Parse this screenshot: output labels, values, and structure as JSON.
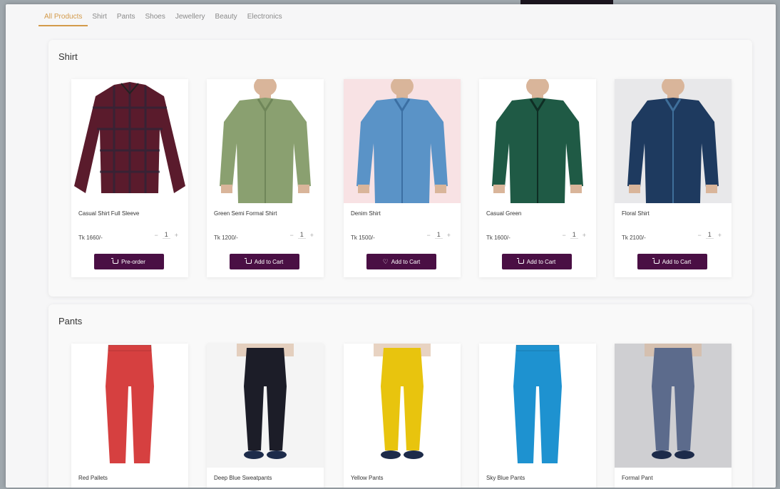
{
  "tabs": [
    "All Products",
    "Shirt",
    "Pants",
    "Shoes",
    "Jewellery",
    "Beauty",
    "Electronics"
  ],
  "active_tab": 0,
  "sections": [
    {
      "title": "Shirt",
      "products": [
        {
          "name": "Casual Shirt Full Sleeve",
          "price": "Tk 1660/-",
          "qty": "1",
          "button": "Pre-order",
          "icon": "cart-icon",
          "bg": "#ffffff",
          "color": "#5a1b2c",
          "accent": "#2b2638",
          "kind": "shirt"
        },
        {
          "name": "Green Semi Formal Shirt",
          "price": "Tk 1200/-",
          "qty": "1",
          "button": "Add to Cart",
          "icon": "cart-icon",
          "bg": "#ffffff",
          "color": "#8aa070",
          "accent": "#6f8659",
          "kind": "shirt-model"
        },
        {
          "name": "Denim Shirt",
          "price": "Tk 1500/-",
          "qty": "1",
          "button": "Add to Cart",
          "icon": "heart-icon",
          "bg": "#f8e2e4",
          "color": "#5a93c7",
          "accent": "#3b6fa3",
          "kind": "shirt-model"
        },
        {
          "name": "Casual Green",
          "price": "Tk 1600/-",
          "qty": "1",
          "button": "Add to Cart",
          "icon": "cart-icon",
          "bg": "#ffffff",
          "color": "#1f5a45",
          "accent": "#0f2e24",
          "kind": "shirt-model"
        },
        {
          "name": "Floral Shirt",
          "price": "Tk 2100/-",
          "qty": "1",
          "button": "Add to Cart",
          "icon": "cart-icon",
          "bg": "#e8e8ea",
          "color": "#1e3a5f",
          "accent": "#3f6f9a",
          "kind": "shirt-model"
        }
      ]
    },
    {
      "title": "Pants",
      "products": [
        {
          "name": "Red Pallets",
          "bg": "#ffffff",
          "color": "#d64040",
          "kind": "pants"
        },
        {
          "name": "Deep Blue Sweatpants",
          "bg": "#f4f4f4",
          "color": "#1c1d28",
          "kind": "pants-model"
        },
        {
          "name": "Yellow Pants",
          "bg": "#ffffff",
          "color": "#e8c40e",
          "kind": "pants-model"
        },
        {
          "name": "Sky Blue Pants",
          "bg": "#ffffff",
          "color": "#1e92d0",
          "kind": "pants"
        },
        {
          "name": "Formal Pant",
          "bg": "#cfcfd2",
          "color": "#5c6b8c",
          "kind": "pants-model"
        }
      ]
    }
  ]
}
